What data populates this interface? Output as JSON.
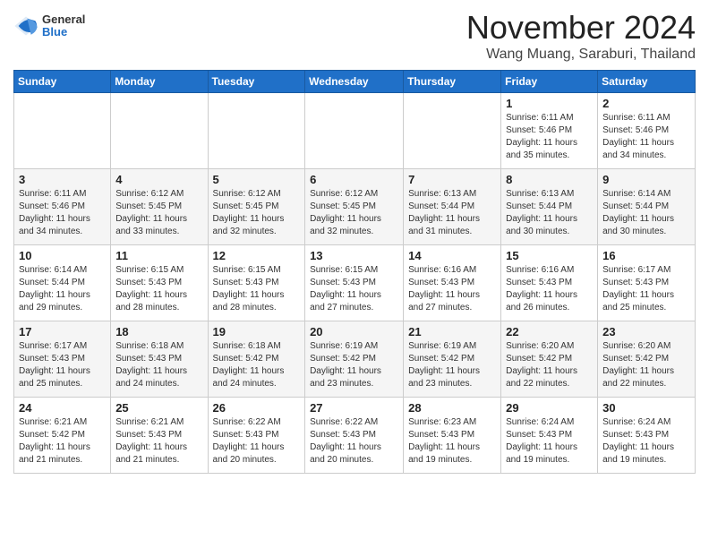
{
  "header": {
    "logo": {
      "general": "General",
      "blue": "Blue"
    },
    "title": "November 2024",
    "location": "Wang Muang, Saraburi, Thailand"
  },
  "days_of_week": [
    "Sunday",
    "Monday",
    "Tuesday",
    "Wednesday",
    "Thursday",
    "Friday",
    "Saturday"
  ],
  "weeks": [
    [
      {
        "day": "",
        "info": ""
      },
      {
        "day": "",
        "info": ""
      },
      {
        "day": "",
        "info": ""
      },
      {
        "day": "",
        "info": ""
      },
      {
        "day": "",
        "info": ""
      },
      {
        "day": "1",
        "info": "Sunrise: 6:11 AM\nSunset: 5:46 PM\nDaylight: 11 hours\nand 35 minutes."
      },
      {
        "day": "2",
        "info": "Sunrise: 6:11 AM\nSunset: 5:46 PM\nDaylight: 11 hours\nand 34 minutes."
      }
    ],
    [
      {
        "day": "3",
        "info": "Sunrise: 6:11 AM\nSunset: 5:46 PM\nDaylight: 11 hours\nand 34 minutes."
      },
      {
        "day": "4",
        "info": "Sunrise: 6:12 AM\nSunset: 5:45 PM\nDaylight: 11 hours\nand 33 minutes."
      },
      {
        "day": "5",
        "info": "Sunrise: 6:12 AM\nSunset: 5:45 PM\nDaylight: 11 hours\nand 32 minutes."
      },
      {
        "day": "6",
        "info": "Sunrise: 6:12 AM\nSunset: 5:45 PM\nDaylight: 11 hours\nand 32 minutes."
      },
      {
        "day": "7",
        "info": "Sunrise: 6:13 AM\nSunset: 5:44 PM\nDaylight: 11 hours\nand 31 minutes."
      },
      {
        "day": "8",
        "info": "Sunrise: 6:13 AM\nSunset: 5:44 PM\nDaylight: 11 hours\nand 30 minutes."
      },
      {
        "day": "9",
        "info": "Sunrise: 6:14 AM\nSunset: 5:44 PM\nDaylight: 11 hours\nand 30 minutes."
      }
    ],
    [
      {
        "day": "10",
        "info": "Sunrise: 6:14 AM\nSunset: 5:44 PM\nDaylight: 11 hours\nand 29 minutes."
      },
      {
        "day": "11",
        "info": "Sunrise: 6:15 AM\nSunset: 5:43 PM\nDaylight: 11 hours\nand 28 minutes."
      },
      {
        "day": "12",
        "info": "Sunrise: 6:15 AM\nSunset: 5:43 PM\nDaylight: 11 hours\nand 28 minutes."
      },
      {
        "day": "13",
        "info": "Sunrise: 6:15 AM\nSunset: 5:43 PM\nDaylight: 11 hours\nand 27 minutes."
      },
      {
        "day": "14",
        "info": "Sunrise: 6:16 AM\nSunset: 5:43 PM\nDaylight: 11 hours\nand 27 minutes."
      },
      {
        "day": "15",
        "info": "Sunrise: 6:16 AM\nSunset: 5:43 PM\nDaylight: 11 hours\nand 26 minutes."
      },
      {
        "day": "16",
        "info": "Sunrise: 6:17 AM\nSunset: 5:43 PM\nDaylight: 11 hours\nand 25 minutes."
      }
    ],
    [
      {
        "day": "17",
        "info": "Sunrise: 6:17 AM\nSunset: 5:43 PM\nDaylight: 11 hours\nand 25 minutes."
      },
      {
        "day": "18",
        "info": "Sunrise: 6:18 AM\nSunset: 5:43 PM\nDaylight: 11 hours\nand 24 minutes."
      },
      {
        "day": "19",
        "info": "Sunrise: 6:18 AM\nSunset: 5:42 PM\nDaylight: 11 hours\nand 24 minutes."
      },
      {
        "day": "20",
        "info": "Sunrise: 6:19 AM\nSunset: 5:42 PM\nDaylight: 11 hours\nand 23 minutes."
      },
      {
        "day": "21",
        "info": "Sunrise: 6:19 AM\nSunset: 5:42 PM\nDaylight: 11 hours\nand 23 minutes."
      },
      {
        "day": "22",
        "info": "Sunrise: 6:20 AM\nSunset: 5:42 PM\nDaylight: 11 hours\nand 22 minutes."
      },
      {
        "day": "23",
        "info": "Sunrise: 6:20 AM\nSunset: 5:42 PM\nDaylight: 11 hours\nand 22 minutes."
      }
    ],
    [
      {
        "day": "24",
        "info": "Sunrise: 6:21 AM\nSunset: 5:42 PM\nDaylight: 11 hours\nand 21 minutes."
      },
      {
        "day": "25",
        "info": "Sunrise: 6:21 AM\nSunset: 5:43 PM\nDaylight: 11 hours\nand 21 minutes."
      },
      {
        "day": "26",
        "info": "Sunrise: 6:22 AM\nSunset: 5:43 PM\nDaylight: 11 hours\nand 20 minutes."
      },
      {
        "day": "27",
        "info": "Sunrise: 6:22 AM\nSunset: 5:43 PM\nDaylight: 11 hours\nand 20 minutes."
      },
      {
        "day": "28",
        "info": "Sunrise: 6:23 AM\nSunset: 5:43 PM\nDaylight: 11 hours\nand 19 minutes."
      },
      {
        "day": "29",
        "info": "Sunrise: 6:24 AM\nSunset: 5:43 PM\nDaylight: 11 hours\nand 19 minutes."
      },
      {
        "day": "30",
        "info": "Sunrise: 6:24 AM\nSunset: 5:43 PM\nDaylight: 11 hours\nand 19 minutes."
      }
    ]
  ]
}
